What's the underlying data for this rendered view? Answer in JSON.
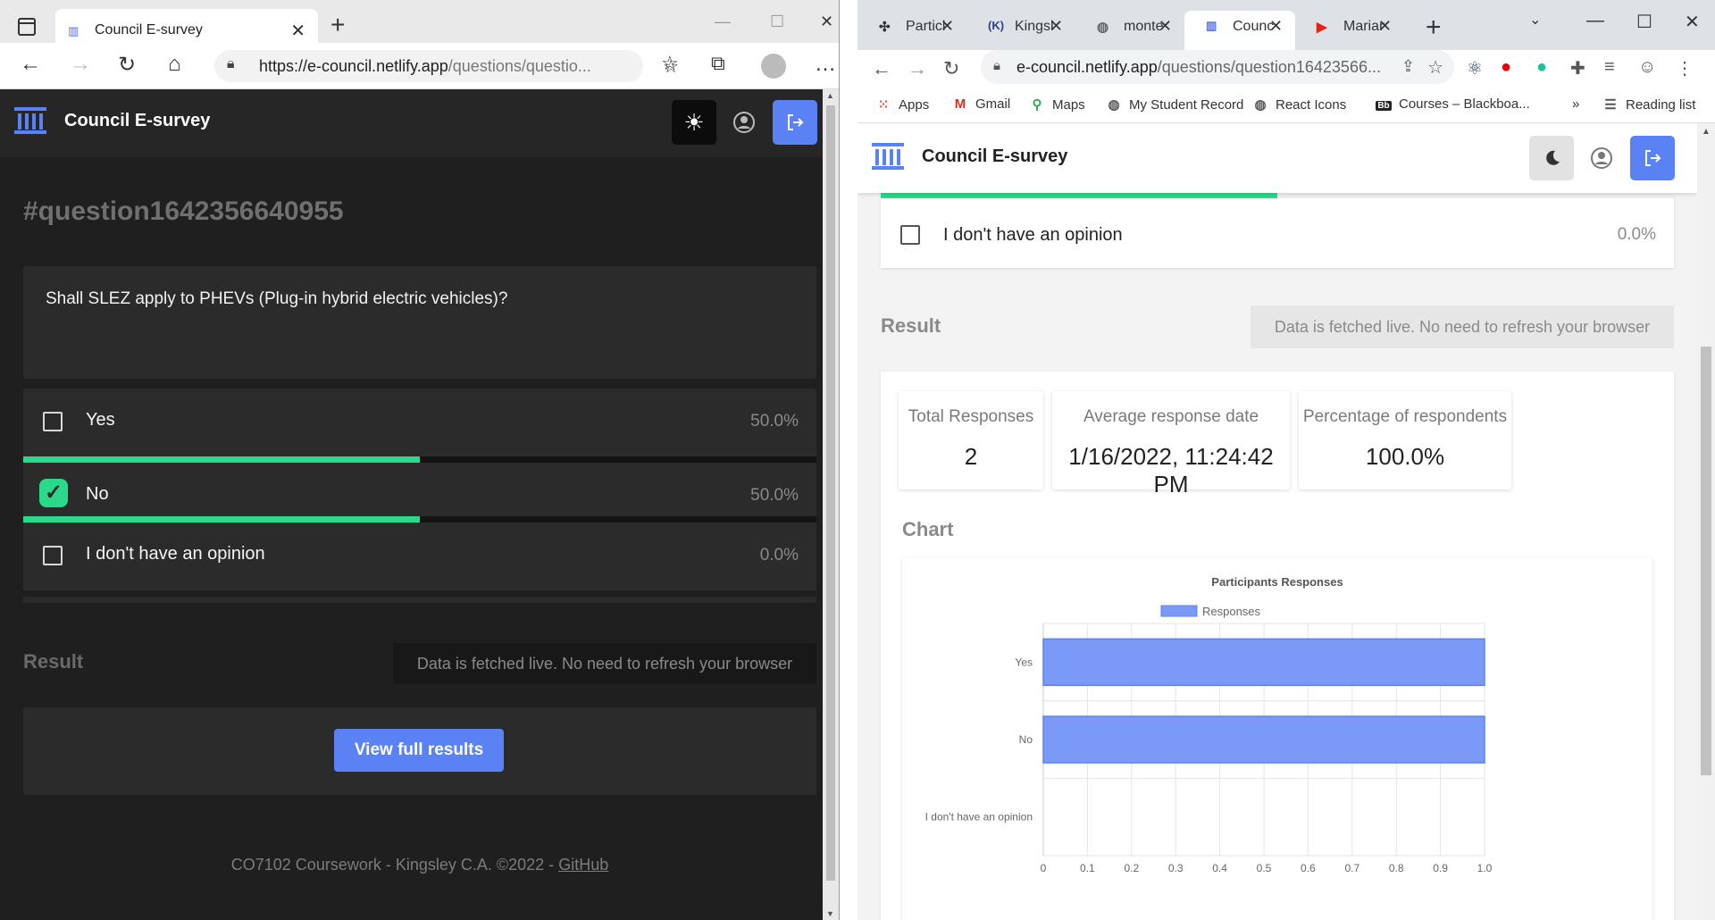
{
  "left_window": {
    "tab": {
      "title": "Council E-survey"
    },
    "url": {
      "host": "https://e-council.netlify.app",
      "path": "/questions/questio..."
    },
    "header": {
      "brand": "Council E-survey"
    },
    "question_id": "#question1642356640955",
    "question_text": "Shall SLEZ apply to PHEVs (Plug-in hybrid electric vehicles)?",
    "options": [
      {
        "label": "Yes",
        "percent": "50.0%",
        "checked": false,
        "fill": 0.5
      },
      {
        "label": "No",
        "percent": "50.0%",
        "checked": true,
        "fill": 0.5
      },
      {
        "label": "I don't have an opinion",
        "percent": "0.0%",
        "checked": false,
        "fill": 0
      }
    ],
    "result_label": "Result",
    "live_note": "Data is fetched live. No need to refresh your browser",
    "view_button": "View full results",
    "footer": {
      "text": "CO7102 Coursework - Kingsley C.A. ©2022 - ",
      "link": "GitHub"
    },
    "colors": {
      "accent": "#5b82f5",
      "success": "#2bd98b",
      "background": "#1f1f1f"
    }
  },
  "right_window": {
    "tabs": [
      {
        "title": "Particl",
        "icon": "particle-icon"
      },
      {
        "title": "Kingsl",
        "icon": "k-icon"
      },
      {
        "title": "monte",
        "icon": "globe-icon"
      },
      {
        "title": "Counc",
        "icon": "council-icon",
        "active": true
      },
      {
        "title": "Marian",
        "icon": "youtube-icon"
      }
    ],
    "url": {
      "host": "e-council.netlify.app",
      "path": "/questions/question16423566..."
    },
    "bookmarks": [
      "Apps",
      "Gmail",
      "Maps",
      "My Student Record",
      "React Icons",
      "Courses – Blackboa...",
      "»",
      "Reading list"
    ],
    "header": {
      "brand": "Council E-survey"
    },
    "option": {
      "label": "I don't have an opinion",
      "percent": "0.0%"
    },
    "result_label": "Result",
    "live_note": "Data is fetched live. No need to refresh your browser",
    "stats": [
      {
        "label": "Total Responses",
        "value": "2"
      },
      {
        "label": "Average response date",
        "value": "1/16/2022, 11:24:42 PM"
      },
      {
        "label": "Percentage of respondents",
        "value": "100.0%"
      }
    ],
    "chart_heading": "Chart"
  },
  "chart_data": {
    "type": "bar",
    "orientation": "horizontal",
    "title": "Participants Responses",
    "categories": [
      "Yes",
      "No",
      "I don't have an opinion"
    ],
    "series": [
      {
        "name": "Responses",
        "values": [
          1,
          1,
          0
        ],
        "color": "#7b9af7"
      }
    ],
    "xlim": [
      0,
      1.0
    ],
    "xticks": [
      "0",
      "0.1",
      "0.2",
      "0.3",
      "0.4",
      "0.5",
      "0.6",
      "0.7",
      "0.8",
      "0.9",
      "1.0"
    ],
    "grid": true,
    "legend": "top-center"
  }
}
